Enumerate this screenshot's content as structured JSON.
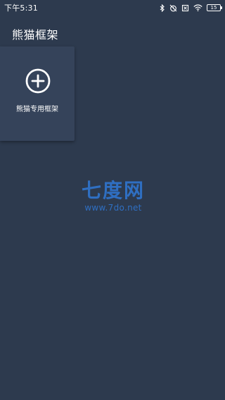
{
  "status_bar": {
    "time": "下午5:31",
    "icons": [
      "bluetooth-icon",
      "alarm-off-icon",
      "no-sim-icon",
      "wifi-icon",
      "battery-icon"
    ],
    "battery_level": "15"
  },
  "app": {
    "title": "熊猫框架"
  },
  "tile": {
    "icon": "add-circle-icon",
    "label": "熊猫专用框架"
  },
  "watermark": {
    "title": "七度网",
    "url": "www.7do.net",
    "color": "#2f6fc2"
  },
  "colors": {
    "background": "#2d3a4e",
    "tile": "#35435a",
    "text": "#ffffff"
  }
}
